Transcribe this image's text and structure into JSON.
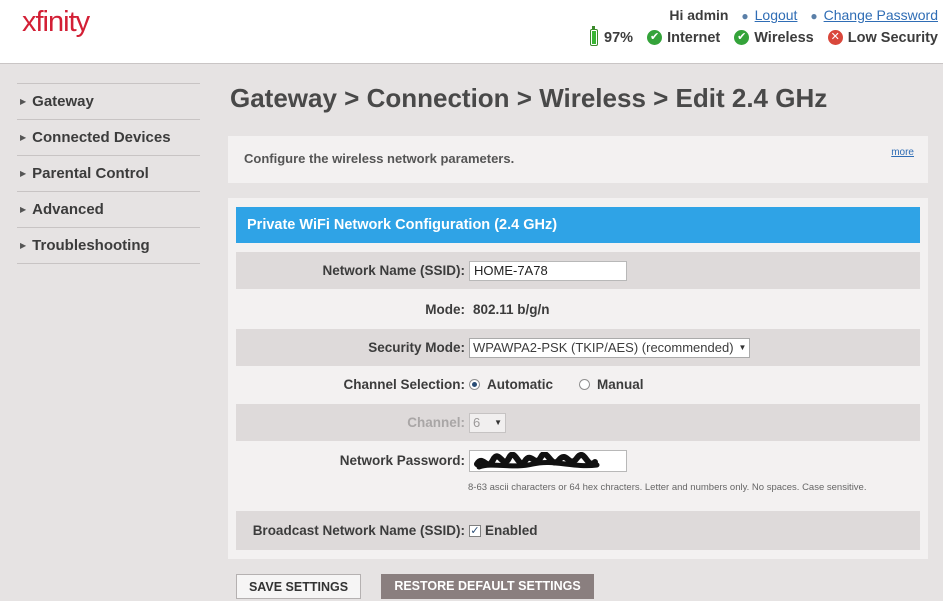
{
  "header": {
    "logo": "xfinity",
    "greeting": "Hi admin",
    "logout": "Logout",
    "change_password": "Change Password",
    "battery": "97%",
    "internet": "Internet",
    "wireless": "Wireless",
    "security": "Low Security",
    "colors": {
      "ok": "#34a33a",
      "warn": "#d9473b",
      "brand": "#d31f35"
    }
  },
  "sidebar": {
    "items": [
      {
        "label": "Gateway"
      },
      {
        "label": "Connected Devices"
      },
      {
        "label": "Parental Control"
      },
      {
        "label": "Advanced"
      },
      {
        "label": "Troubleshooting"
      }
    ]
  },
  "main": {
    "title": "Gateway > Connection > Wireless > Edit 2.4 GHz",
    "info": "Configure the wireless network parameters.",
    "more": "more",
    "panel_title": "Private WiFi Network Configuration (2.4 GHz)",
    "accent": "#2fa3e6",
    "fields": {
      "ssid_label": "Network Name (SSID):",
      "ssid_value": "HOME-7A78",
      "mode_label": "Mode:",
      "mode_value": "802.11 b/g/n",
      "security_label": "Security Mode:",
      "security_value": "WPAWPA2-PSK (TKIP/AES) (recommended)",
      "channel_sel_label": "Channel Selection:",
      "channel_auto": "Automatic",
      "channel_manual": "Manual",
      "channel_label": "Channel:",
      "channel_value": "6",
      "password_label": "Network Password:",
      "password_hint": "8-63 ascii characters or 64 hex chracters. Letter and numbers only. No spaces. Case sensitive.",
      "broadcast_label": "Broadcast Network Name (SSID):",
      "broadcast_value": "Enabled"
    },
    "buttons": {
      "save": "SAVE SETTINGS",
      "restore": "RESTORE DEFAULT SETTINGS"
    }
  }
}
